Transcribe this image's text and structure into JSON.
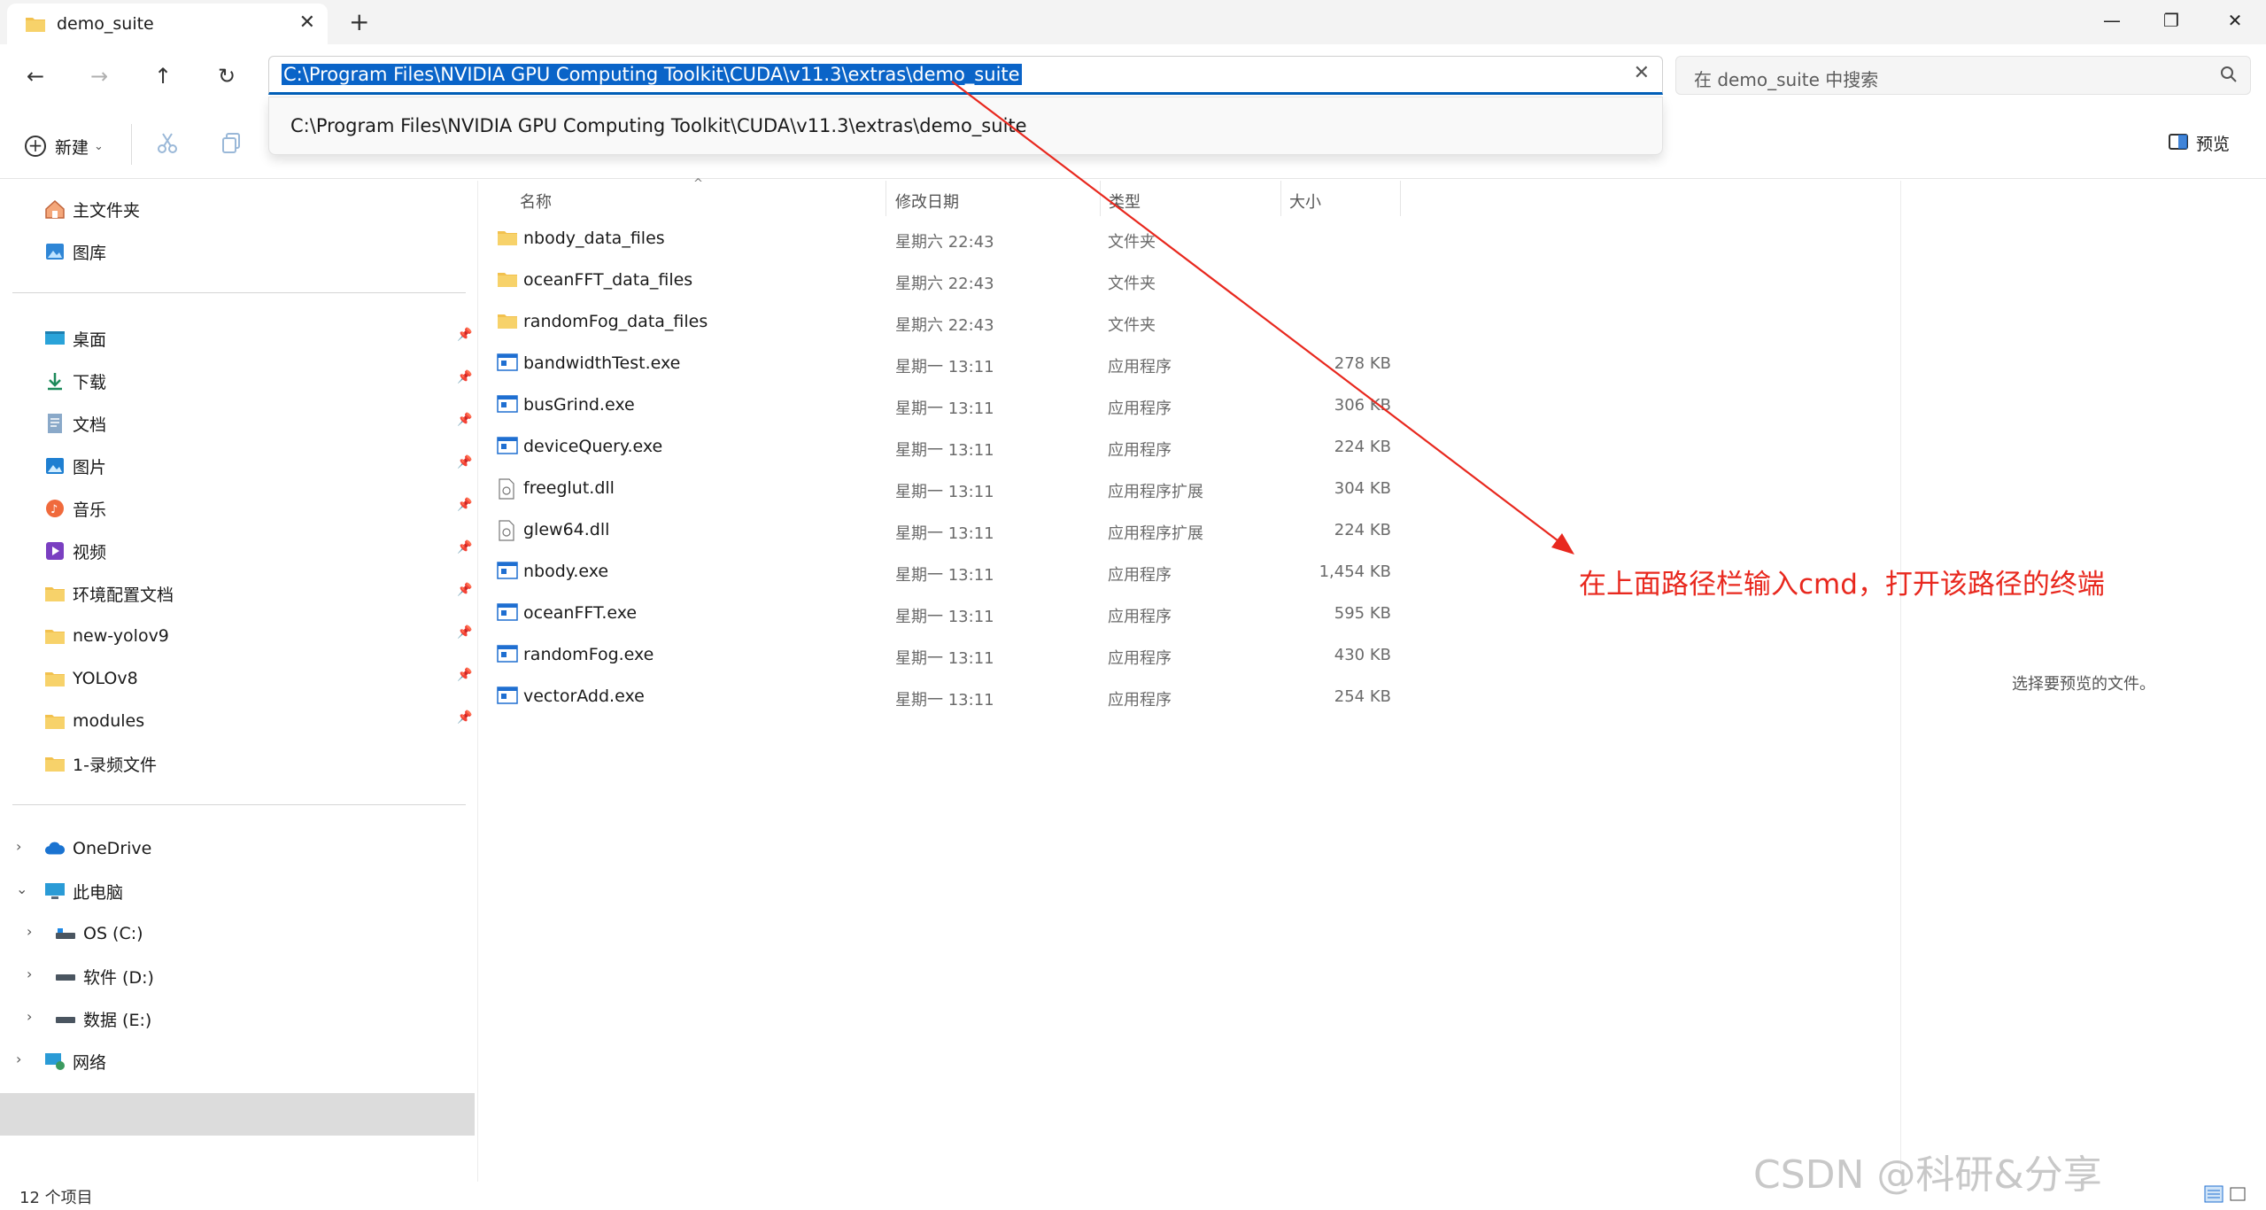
{
  "window": {
    "tab_title": "demo_suite",
    "tab_close_glyph": "✕",
    "new_tab_glyph": "+",
    "minimize_glyph": "—",
    "restore_glyph": "❐",
    "close_glyph": "✕"
  },
  "nav": {
    "back_glyph": "←",
    "forward_glyph": "→",
    "up_glyph": "↑",
    "refresh_glyph": "↻"
  },
  "address": {
    "value": "C:\\Program Files\\NVIDIA GPU Computing Toolkit\\CUDA\\v11.3\\extras\\demo_suite",
    "clear_glyph": "✕",
    "suggestion": "C:\\Program Files\\NVIDIA GPU Computing Toolkit\\CUDA\\v11.3\\extras\\demo_suite"
  },
  "search": {
    "placeholder": "在 demo_suite 中搜索"
  },
  "toolbar": {
    "new_label": "新建",
    "preview_label": "预览"
  },
  "sidebar": {
    "top_items": [
      {
        "label": "主文件夹",
        "icon": "home-icon"
      },
      {
        "label": "图库",
        "icon": "gallery-icon"
      }
    ],
    "pinned_items": [
      {
        "label": "桌面",
        "icon": "desktop-icon"
      },
      {
        "label": "下载",
        "icon": "download-icon"
      },
      {
        "label": "文档",
        "icon": "document-icon"
      },
      {
        "label": "图片",
        "icon": "pictures-icon"
      },
      {
        "label": "音乐",
        "icon": "music-icon"
      },
      {
        "label": "视频",
        "icon": "video-icon"
      },
      {
        "label": "环境配置文档",
        "icon": "folder-icon"
      },
      {
        "label": "new-yolov9",
        "icon": "folder-icon"
      },
      {
        "label": "YOLOv8",
        "icon": "folder-icon"
      },
      {
        "label": "modules",
        "icon": "folder-icon"
      },
      {
        "label": "1-录频文件",
        "icon": "folder-icon"
      }
    ],
    "tree_items": [
      {
        "label": "OneDrive",
        "icon": "cloud-icon"
      },
      {
        "label": "此电脑",
        "icon": "computer-icon"
      },
      {
        "label": "OS (C:)",
        "icon": "drive-icon"
      },
      {
        "label": "软件 (D:)",
        "icon": "drive-icon"
      },
      {
        "label": "数据 (E:)",
        "icon": "drive-icon"
      },
      {
        "label": "网络",
        "icon": "network-icon"
      }
    ]
  },
  "files": {
    "columns": {
      "name": "名称",
      "date": "修改日期",
      "type": "类型",
      "size": "大小"
    },
    "rows": [
      {
        "name": "nbody_data_files",
        "date": "星期六 22:43",
        "type": "文件夹",
        "size": "",
        "icon": "folder-icon"
      },
      {
        "name": "oceanFFT_data_files",
        "date": "星期六 22:43",
        "type": "文件夹",
        "size": "",
        "icon": "folder-icon"
      },
      {
        "name": "randomFog_data_files",
        "date": "星期六 22:43",
        "type": "文件夹",
        "size": "",
        "icon": "folder-icon"
      },
      {
        "name": "bandwidthTest.exe",
        "date": "星期一 13:11",
        "type": "应用程序",
        "size": "278 KB",
        "icon": "exe-icon"
      },
      {
        "name": "busGrind.exe",
        "date": "星期一 13:11",
        "type": "应用程序",
        "size": "306 KB",
        "icon": "exe-icon"
      },
      {
        "name": "deviceQuery.exe",
        "date": "星期一 13:11",
        "type": "应用程序",
        "size": "224 KB",
        "icon": "exe-icon"
      },
      {
        "name": "freeglut.dll",
        "date": "星期一 13:11",
        "type": "应用程序扩展",
        "size": "304 KB",
        "icon": "dll-icon"
      },
      {
        "name": "glew64.dll",
        "date": "星期一 13:11",
        "type": "应用程序扩展",
        "size": "224 KB",
        "icon": "dll-icon"
      },
      {
        "name": "nbody.exe",
        "date": "星期一 13:11",
        "type": "应用程序",
        "size": "1,454 KB",
        "icon": "exe-icon"
      },
      {
        "name": "oceanFFT.exe",
        "date": "星期一 13:11",
        "type": "应用程序",
        "size": "595 KB",
        "icon": "exe-icon"
      },
      {
        "name": "randomFog.exe",
        "date": "星期一 13:11",
        "type": "应用程序",
        "size": "430 KB",
        "icon": "exe-icon"
      },
      {
        "name": "vectorAdd.exe",
        "date": "星期一 13:11",
        "type": "应用程序",
        "size": "254 KB",
        "icon": "exe-icon"
      }
    ]
  },
  "preview": {
    "empty_text": "选择要预览的文件。"
  },
  "status": {
    "count": "12 个项目"
  },
  "annotation": {
    "text": "在上面路径栏输入cmd，打开该路径的终端",
    "color": "#e8281e"
  },
  "watermark": {
    "text": "CSDN @科研&分享"
  },
  "colors": {
    "accent": "#005fb8",
    "selection": "#0a64c8",
    "folder": "#f2c14e"
  }
}
